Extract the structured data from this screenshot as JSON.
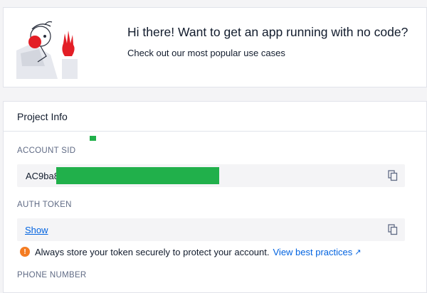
{
  "promo": {
    "title": "Hi there! Want to get an app running with no code?",
    "subtitle": "Check out our most popular use cases"
  },
  "project_info": {
    "title": "Project Info",
    "account_sid": {
      "label": "ACCOUNT SID",
      "value_prefix": "AC9ba8"
    },
    "auth_token": {
      "label": "AUTH TOKEN",
      "show_link": "Show"
    },
    "warning": {
      "text": "Always store your token securely to protect your account.",
      "link": "View best practices",
      "link_icon": "↗"
    },
    "phone_number": {
      "label": "PHONE NUMBER"
    }
  },
  "colors": {
    "link": "#0263e0",
    "warning": "#f47c22",
    "redaction": "#21b04b",
    "mascot_red": "#e31e26"
  },
  "icons": [
    "mascot-illustration",
    "copy-icon",
    "warning-icon",
    "external-link-icon"
  ]
}
